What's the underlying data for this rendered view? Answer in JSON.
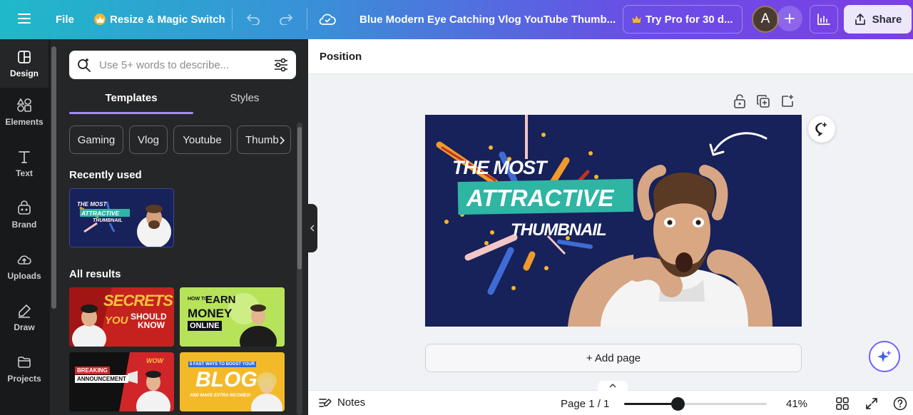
{
  "topbar": {
    "file_label": "File",
    "resize_label": "Resize & Magic Switch",
    "doc_title": "Blue Modern Eye Catching Vlog YouTube Thumb...",
    "try_pro_label": "Try Pro for 30 d...",
    "avatar_initial": "A",
    "share_label": "Share"
  },
  "rail": {
    "items": [
      {
        "label": "Design",
        "icon": "design-icon"
      },
      {
        "label": "Elements",
        "icon": "elements-icon"
      },
      {
        "label": "Text",
        "icon": "text-icon"
      },
      {
        "label": "Brand",
        "icon": "brand-icon"
      },
      {
        "label": "Uploads",
        "icon": "uploads-icon"
      },
      {
        "label": "Draw",
        "icon": "draw-icon"
      },
      {
        "label": "Projects",
        "icon": "projects-icon"
      }
    ]
  },
  "panel": {
    "search_placeholder": "Use 5+ words to describe...",
    "tabs": [
      "Templates",
      "Styles"
    ],
    "chips": [
      "Gaming",
      "Vlog",
      "Youtube",
      "Thumb"
    ],
    "recently_used": "Recently used",
    "all_results": "All results",
    "recent_thumb": {
      "line1": "THE MOST",
      "line2": "ATTRACTIVE",
      "line3": "THUMBNAIL"
    },
    "results": [
      {
        "lines": [
          "SECRETS",
          "YOU",
          "SHOULD",
          "KNOW"
        ]
      },
      {
        "lines": [
          "HOW TO",
          "EARN",
          "MONEY",
          "ONLINE"
        ]
      },
      {
        "lines": [
          "BREAKING",
          "ANNOUNCEMENT",
          "WOW"
        ]
      },
      {
        "lines": [
          "5 FAST WAYS TO BOOST YOUR",
          "BLOG",
          "AND MAKE EXTRA INCOMES!"
        ]
      }
    ]
  },
  "editor": {
    "position_label": "Position",
    "add_page_label": "+ Add page",
    "canvas": {
      "line1": "THE MOST",
      "line2": "ATTRACTIVE",
      "line3": "THUMBNAIL"
    }
  },
  "bottom": {
    "notes_label": "Notes",
    "page_label": "Page 1 / 1",
    "zoom_label": "41%",
    "zoom_fraction": 0.41
  },
  "colors": {
    "canvas_bg": "#17215a",
    "accent_teal": "#2eb5a4",
    "accent_purple": "#a48df5"
  }
}
